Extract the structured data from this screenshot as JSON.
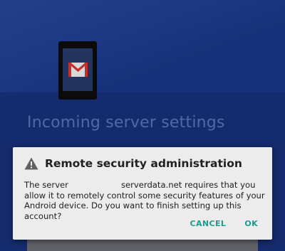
{
  "background": {
    "title": "Incoming server settings",
    "illustration_icon": "gmail-icon"
  },
  "dialog": {
    "title": "Remote security administration",
    "icon": "warning-icon",
    "message_prefix": "The server",
    "message_rest": "serverdata.net requires that you allow it to remotely control some security features of your Android device. Do you want to finish setting up this account?",
    "cancel_label": "CANCEL",
    "ok_label": "OK"
  },
  "colors": {
    "accent": "#1b9c8e",
    "dialog_bg": "#ececec",
    "scrim_bg": "#132a66"
  }
}
